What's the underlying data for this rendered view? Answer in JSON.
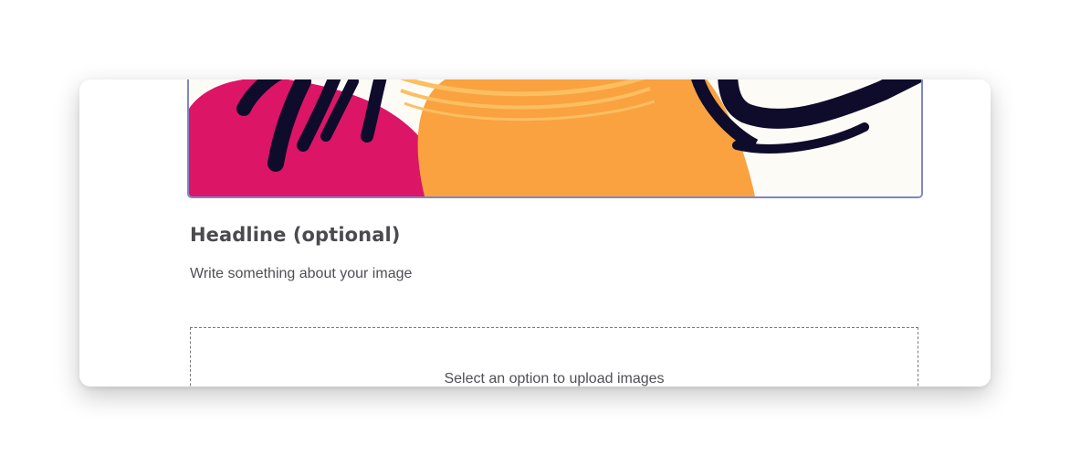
{
  "editor": {
    "image_block": {
      "headline": "Headline (optional)",
      "caption_placeholder": "Write something about your image"
    },
    "upload": {
      "prompt": "Select an option to upload images"
    }
  },
  "colors": {
    "frame_border": "#7f86c8",
    "magenta": "#dc1566",
    "orange": "#f9a23f",
    "ink": "#0e0b2b",
    "cream": "#fdfbf6"
  }
}
